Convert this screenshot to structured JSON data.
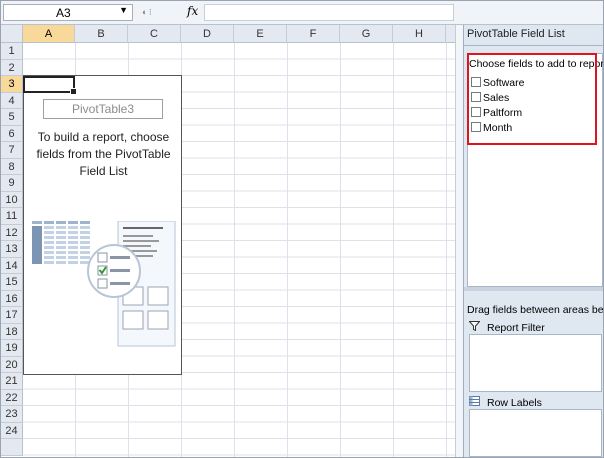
{
  "formula_bar": {
    "name_box": "A3",
    "fx_label": "fx",
    "formula": ""
  },
  "grid": {
    "columns": [
      "A",
      "B",
      "C",
      "D",
      "E",
      "F",
      "G",
      "H"
    ],
    "rows": [
      "1",
      "2",
      "3",
      "4",
      "5",
      "6",
      "7",
      "8",
      "9",
      "10",
      "11",
      "12",
      "13",
      "14",
      "15",
      "16",
      "17",
      "18",
      "19",
      "20",
      "21",
      "22",
      "23",
      "24"
    ],
    "selected_column": "A",
    "selected_row": "3"
  },
  "pivot_placeholder": {
    "name": "PivotTable3",
    "instruction": "To build a report, choose fields from the PivotTable Field List"
  },
  "field_list": {
    "title": "PivotTable Field List",
    "choose_label": "Choose fields to add to report:",
    "fields": [
      {
        "label": "Software",
        "checked": false
      },
      {
        "label": "Sales",
        "checked": false
      },
      {
        "label": "Paltform",
        "checked": false
      },
      {
        "label": "Month",
        "checked": false
      }
    ],
    "drag_label": "Drag fields between areas below:",
    "areas": [
      {
        "label": "Report Filter",
        "icon": "filter-icon"
      },
      {
        "label": "Row Labels",
        "icon": "row-labels-icon"
      }
    ]
  },
  "colors": {
    "highlight": "#e0141e",
    "selected_header": "#f9d99a",
    "header_bg": "#e4e9f1",
    "pane_bg": "#dfe7f1"
  }
}
